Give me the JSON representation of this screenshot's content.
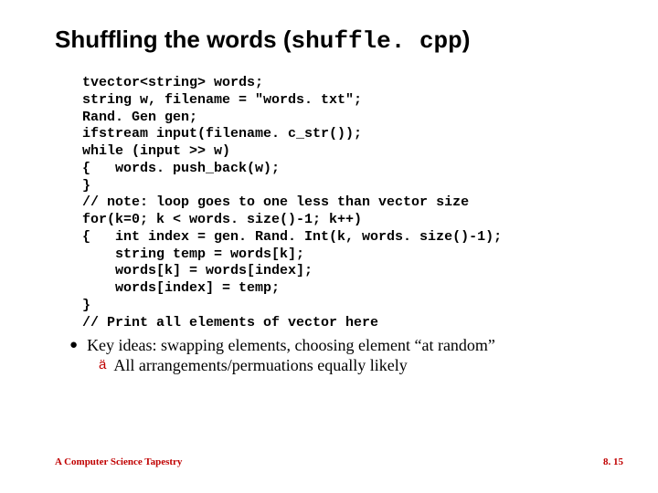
{
  "title_prefix": "Shuffling the words (",
  "title_mono": "shuffle. cpp",
  "title_suffix": ")",
  "code": "tvector<string> words;\nstring w, filename = \"words. txt\";\nRand. Gen gen;\nifstream input(filename. c_str());\nwhile (input >> w)\n{   words. push_back(w);\n}\n// note: loop goes to one less than vector size\nfor(k=0; k < words. size()-1; k++)\n{   int index = gen. Rand. Int(k, words. size()-1);\n    string temp = words[k];\n    words[k] = words[index];\n    words[index] = temp;\n}\n// Print all elements of vector here",
  "bullet": "Key ideas: swapping elements, choosing element “at random”",
  "sub": "All arrangements/permuations equally likely",
  "footer_left": "A Computer Science Tapestry",
  "footer_right": "8. 15"
}
